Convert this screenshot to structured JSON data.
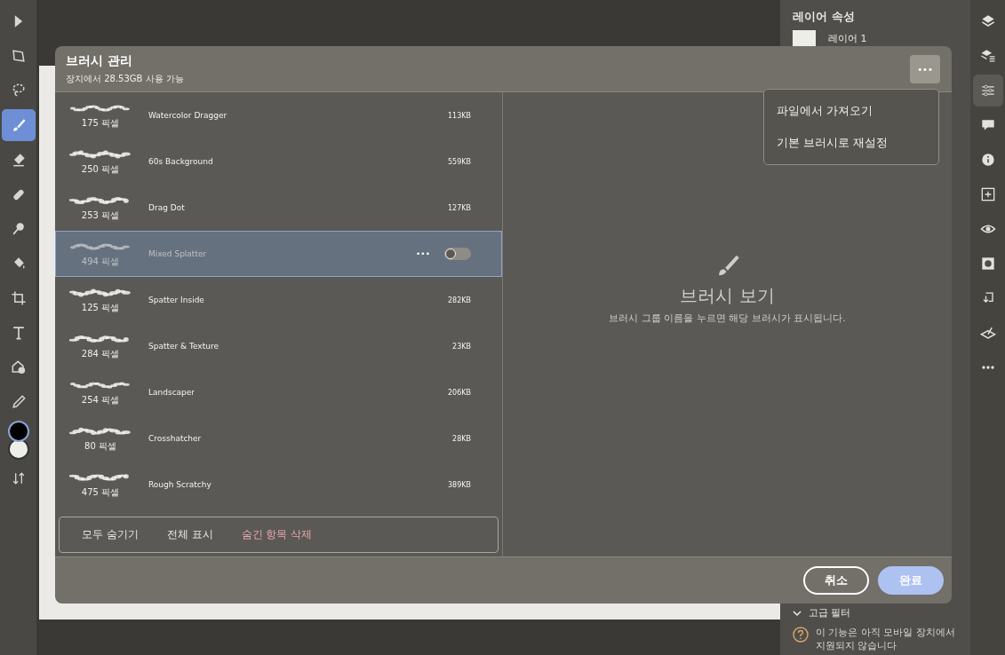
{
  "toolbar": {
    "tools": [
      {
        "kind": "select",
        "selected": false
      },
      {
        "kind": "transform",
        "selected": false
      },
      {
        "kind": "lasso",
        "selected": false
      },
      {
        "kind": "brush",
        "selected": true
      },
      {
        "kind": "eraser",
        "selected": false
      },
      {
        "kind": "heal",
        "selected": false
      },
      {
        "kind": "smudge",
        "selected": false
      },
      {
        "kind": "fill",
        "selected": false
      },
      {
        "kind": "crop",
        "selected": false
      },
      {
        "kind": "text",
        "selected": false
      },
      {
        "kind": "image",
        "selected": false
      },
      {
        "kind": "eyedropper",
        "selected": false
      },
      {
        "kind": "colors"
      },
      {
        "kind": "swap",
        "selected": false
      }
    ]
  },
  "properties_panel": {
    "title": "레이어 속성",
    "layer_name": "레이어 1",
    "section": "고급 필터",
    "notice": "이 기능은 아직 모바일 장치에서 지원되지 않습니다"
  },
  "rail": {
    "icons": [
      {
        "kind": "layers",
        "selected": false
      },
      {
        "kind": "layer-props",
        "selected": false
      },
      {
        "kind": "adjust",
        "selected": true
      },
      {
        "kind": "comment",
        "selected": false
      },
      {
        "kind": "info",
        "selected": false
      },
      {
        "kind": "add",
        "selected": false
      },
      {
        "kind": "eye",
        "selected": false
      },
      {
        "kind": "mask",
        "selected": false
      },
      {
        "kind": "import",
        "selected": false
      },
      {
        "kind": "clip",
        "selected": false
      },
      {
        "kind": "more",
        "selected": false
      }
    ]
  },
  "dialog": {
    "title": "브러시 관리",
    "subtitle": "장치에서 28.53GB 사용 가능",
    "more_button": "•••",
    "menu": [
      "파일에서 가져오기",
      "기본 브러시로 재설정"
    ],
    "brushes": [
      {
        "name": "Watercolor Dragger",
        "pixels": "175 픽셀",
        "size": "113KB",
        "selected": false
      },
      {
        "name": "60s Background",
        "pixels": "250 픽셀",
        "size": "559KB",
        "selected": false
      },
      {
        "name": "Drag Dot",
        "pixels": "253 픽셀",
        "size": "127KB",
        "selected": false
      },
      {
        "name": "Mixed Splatter",
        "pixels": "494 픽셀",
        "selected": true,
        "row_menu": "•••",
        "on": false
      },
      {
        "name": "Spatter Inside",
        "pixels": "125 픽셀",
        "size": "282KB",
        "selected": false
      },
      {
        "name": "Spatter & Texture",
        "pixels": "284 픽셀",
        "size": "23KB",
        "selected": false
      },
      {
        "name": "Landscaper",
        "pixels": "254 픽셀",
        "size": "206KB",
        "selected": false
      },
      {
        "name": "Crosshatcher",
        "pixels": "80 픽셀",
        "size": "28KB",
        "selected": false
      },
      {
        "name": "Rough Scratchy",
        "pixels": "475 픽셀",
        "size": "389KB",
        "selected": false
      }
    ],
    "list_actions": [
      {
        "label": "모두 숨기기",
        "kind": "normal"
      },
      {
        "label": "전체 표시",
        "kind": "normal"
      },
      {
        "label": "숨긴 항목 삭제",
        "kind": "destructive"
      }
    ],
    "preview": {
      "title": "브러시 보기",
      "hint": "브러시 그룹 이름을 누르면 해당 브러시가 표시됩니다."
    },
    "buttons": [
      {
        "label": "취소",
        "kind": "secondary"
      },
      {
        "label": "완료",
        "kind": "primary"
      }
    ]
  }
}
